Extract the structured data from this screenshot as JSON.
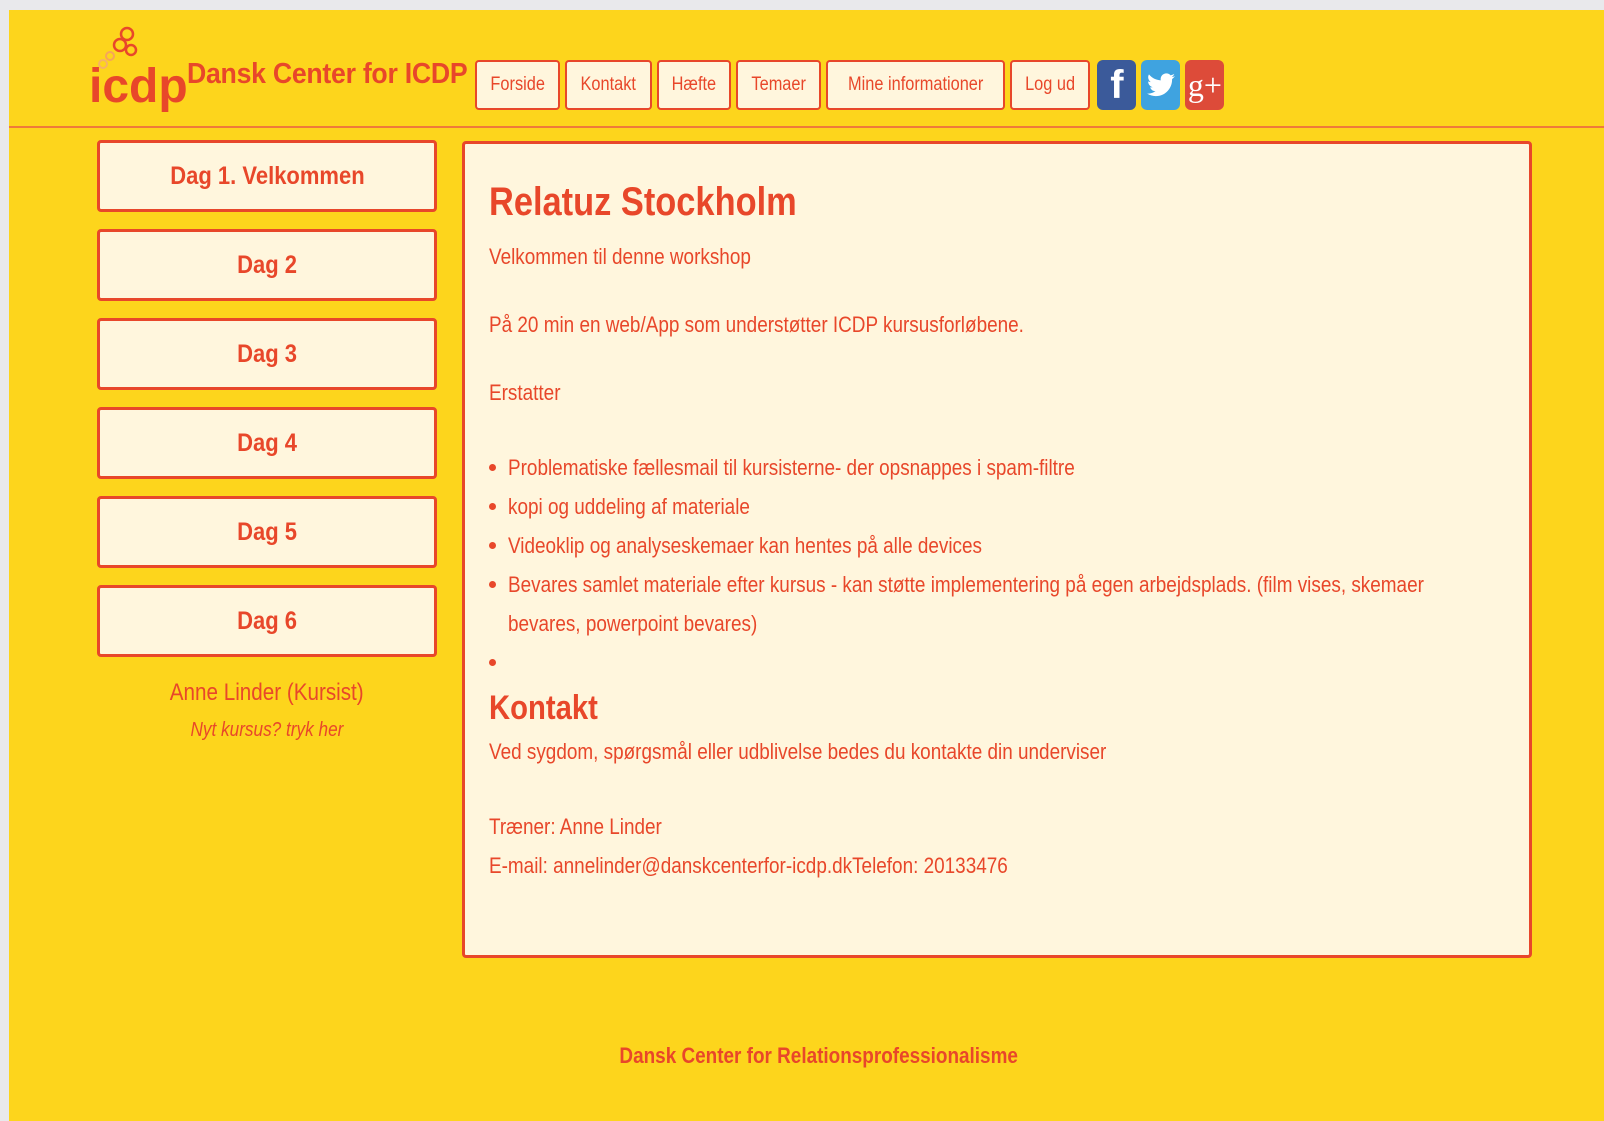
{
  "brand": {
    "logo_mark": "icdp",
    "name": "Dansk Center for ICDP",
    "color_accent": "#e8472a",
    "color_background": "#fdd51c",
    "color_panel": "#fff6dd"
  },
  "nav": {
    "items": [
      "Forside",
      "Kontakt",
      "Hæfte",
      "Temaer",
      "Mine informationer",
      "Log ud"
    ],
    "social": [
      {
        "icon": "facebook-icon",
        "glyph": "f",
        "color": "#3b5a9a"
      },
      {
        "icon": "twitter-icon",
        "glyph": "",
        "color": "#3fa3e0"
      },
      {
        "icon": "google-plus-icon",
        "glyph": "g+",
        "color": "#dd4b39"
      }
    ]
  },
  "sidebar": {
    "days": [
      "Dag 1. Velkommen",
      "Dag 2",
      "Dag 3",
      "Dag 4",
      "Dag 5",
      "Dag 6"
    ],
    "user": "Anne Linder (Kursist)",
    "new_course": "Nyt kursus? tryk her"
  },
  "main": {
    "title": "Relatuz Stockholm",
    "welcome": "Velkommen til denne workshop",
    "intro": "På 20 min en web/App som understøtter ICDP kursusforløbene.",
    "replaces_label": "Erstatter",
    "bullets": [
      "Problematiske fællesmail til kursisterne- der opsnappes i spam-filtre",
      "kopi og uddeling af materiale",
      "Videoklip og analyseskemaer kan hentes på alle devices",
      "Bevares samlet materiale efter kursus - kan støtte implementering på egen arbejdsplads. (film vises, skemaer",
      "bevares, powerpoint bevares)"
    ],
    "contact_title": "Kontakt",
    "contact_text": "Ved sygdom, spørgsmål eller udblivelse bedes du kontakte din underviser",
    "trainer": "Træner: Anne Linder",
    "email_phone": "E-mail: annelinder@danskcenterfor-icdp.dkTelefon: 20133476"
  },
  "footer": {
    "text": "Dansk Center for Relationsprofessionalisme"
  }
}
